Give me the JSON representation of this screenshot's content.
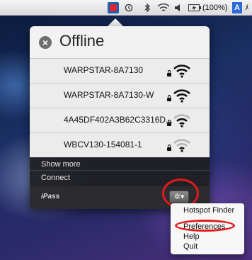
{
  "menubar": {
    "battery": "(100%)",
    "input_letter": "A",
    "trailing": "ﾒ"
  },
  "panel": {
    "status": "Offline",
    "networks": [
      {
        "name": "WARPSTAR-8A7130",
        "locked": true,
        "signal": 4
      },
      {
        "name": "WARPSTAR-8A7130-W",
        "locked": true,
        "signal": 4
      },
      {
        "name": "4A45DF402A3B62C3316D...",
        "locked": true,
        "signal": 3
      },
      {
        "name": "WBCV130-154081-1",
        "locked": true,
        "signal": 2
      }
    ],
    "actions": {
      "show_more": "Show more",
      "connect": "Connect"
    },
    "brand": "iPass"
  },
  "menu": {
    "items": [
      "Hotspot Finder",
      "Preferences",
      "Help",
      "Quit"
    ]
  },
  "colors": {
    "highlight": "#e31b1b",
    "panel_bg": "#1e1e20"
  }
}
